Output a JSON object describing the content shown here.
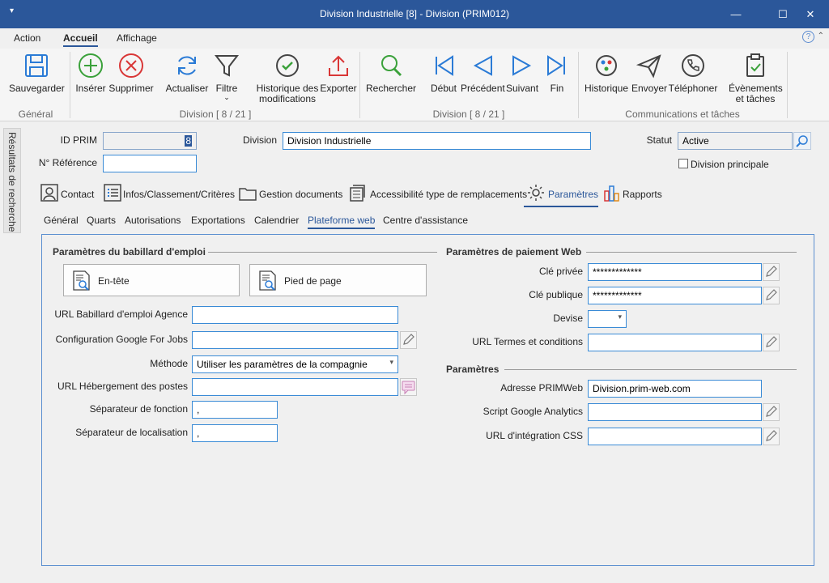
{
  "window": {
    "title": "Division Industrielle [8] - Division (PRIM012)",
    "minimize": "—",
    "maximize": "☐",
    "close": "✕"
  },
  "ribbon_tabs": [
    "Action",
    "Accueil",
    "Affichage"
  ],
  "ribbon": {
    "buttons": {
      "save": "Sauvegarder",
      "insert": "Insérer",
      "delete": "Supprimer",
      "refresh": "Actualiser",
      "filter": "Filtre",
      "history_line1": "Historique des",
      "history_line2": "modifications",
      "export": "Exporter",
      "search": "Rechercher",
      "first": "Début",
      "previous": "Précédent",
      "next": "Suivant",
      "last": "Fin",
      "comm_history": "Historique",
      "send": "Envoyer",
      "phone": "Téléphoner",
      "events_line1": "Évènements",
      "events_line2": "et tâches"
    },
    "groups": {
      "general": "Général",
      "division1": "Division [ 8 / 21 ]",
      "division2": "Division [ 8 / 21 ]",
      "comms": "Communications et tâches"
    }
  },
  "side_panel": "Résultats de recherche",
  "header": {
    "id_label": "ID PRIM",
    "id_value": "8",
    "ref_label": "N° Référence",
    "ref_value": "",
    "division_label": "Division",
    "division_value": "Division Industrielle",
    "status_label": "Statut",
    "status_value": "Active",
    "main_division_label": "Division principale"
  },
  "main_tabs": [
    "Contact",
    "Infos/Classement/Critères",
    "Gestion documents",
    "Accessibilité type de remplacements",
    "Paramètres",
    "Rapports"
  ],
  "sub_tabs": [
    "Général",
    "Quarts",
    "Autorisations",
    "Exportations",
    "Calendrier",
    "Plateforme web",
    "Centre d'assistance"
  ],
  "job_board": {
    "title": "Paramètres du babillard d'emploi",
    "header_btn": "En-tête",
    "footer_btn": "Pied de page",
    "fields": {
      "url_agency": {
        "label": "URL Babillard d'emploi Agence",
        "value": ""
      },
      "google_jobs": {
        "label": "Configuration Google For Jobs",
        "value": ""
      },
      "method": {
        "label": "Méthode",
        "value": "Utiliser les paramètres de la compagnie"
      },
      "hosting_url": {
        "label": "URL Hébergement des postes",
        "value": ""
      },
      "function_sep": {
        "label": "Séparateur de fonction",
        "value": ","
      },
      "location_sep": {
        "label": "Séparateur de localisation",
        "value": ","
      }
    }
  },
  "web_payment": {
    "title": "Paramètres de paiement Web",
    "fields": {
      "private_key": {
        "label": "Clé privée",
        "value": "*************"
      },
      "public_key": {
        "label": "Clé publique",
        "value": "*************"
      },
      "currency": {
        "label": "Devise",
        "value": ""
      },
      "terms_url": {
        "label": "URL Termes et conditions",
        "value": ""
      }
    }
  },
  "params": {
    "title": "Paramètres",
    "fields": {
      "primweb": {
        "label": "Adresse PRIMWeb",
        "value": "Division.prim-web.com"
      },
      "analytics": {
        "label": "Script Google Analytics",
        "value": ""
      },
      "css_url": {
        "label": "URL d'intégration CSS",
        "value": ""
      }
    }
  },
  "colors": {
    "titlebar": "#2b579a",
    "accent": "#2b579a",
    "field_border": "#3a8bd6",
    "green": "#3aa13a",
    "red": "#d93636"
  }
}
